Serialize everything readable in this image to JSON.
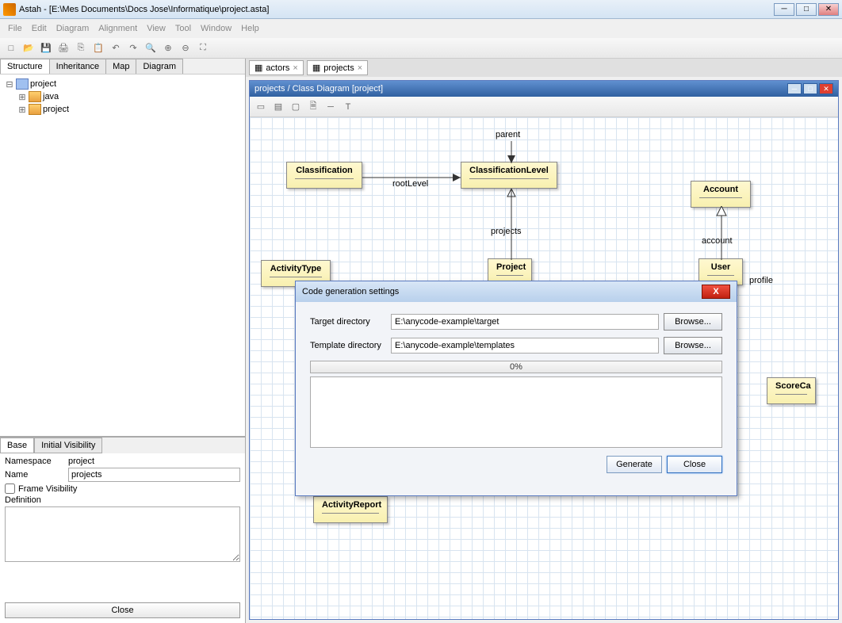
{
  "window": {
    "title": "Astah - [E:\\Mes Documents\\Docs Jose\\Informatique\\project.asta]"
  },
  "menu": {
    "file": "File",
    "edit": "Edit",
    "diagram": "Diagram",
    "alignment": "Alignment",
    "view": "View",
    "tool": "Tool",
    "window": "Window",
    "help": "Help"
  },
  "side_tabs": {
    "structure": "Structure",
    "inheritance": "Inheritance",
    "map": "Map",
    "diagram": "Diagram"
  },
  "tree": {
    "root": "project",
    "items": [
      "java",
      "project"
    ]
  },
  "prop_tabs": {
    "base": "Base",
    "initial": "Initial Visibility"
  },
  "props": {
    "namespace_label": "Namespace",
    "namespace_value": "project",
    "name_label": "Name",
    "name_value": "projects",
    "frame_label": "Frame Visibility",
    "definition_label": "Definition",
    "close": "Close"
  },
  "doc_tabs": {
    "actors": "actors",
    "projects": "projects"
  },
  "diagram": {
    "title": "projects / Class Diagram [project]",
    "classes": {
      "classification": "Classification",
      "classification_level": "ClassificationLevel",
      "account": "Account",
      "activity_type": "ActivityType",
      "project": "Project",
      "user": "User",
      "score_card": "ScoreCa",
      "activity_report": "ActivityReport"
    },
    "labels": {
      "parent": "parent",
      "root_level": "rootLevel",
      "projects": "projects",
      "account": "account",
      "profile": "profile"
    }
  },
  "dialog": {
    "title": "Code generation settings",
    "target_label": "Target directory",
    "target_value": "E:\\anycode-example\\target",
    "template_label": "Template directory",
    "template_value": "E:\\anycode-example\\templates",
    "browse": "Browse...",
    "progress": "0%",
    "generate": "Generate",
    "close": "Close"
  }
}
